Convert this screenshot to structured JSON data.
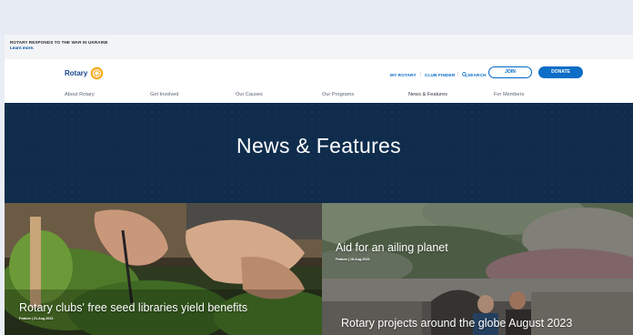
{
  "alert": {
    "headline": "ROTARY RESPONDS TO THE WAR IN UKRAINE",
    "link": "Learn more."
  },
  "header": {
    "logo_text": "Rotary",
    "utility_links": [
      "MY ROTARY",
      "CLUB FINDER",
      "SEARCH"
    ],
    "join_label": "JOIN",
    "donate_label": "DONATE"
  },
  "nav": {
    "items": [
      "About Rotary",
      "Get Involved",
      "Our Causes",
      "Our Programs",
      "News & Features",
      "For Members"
    ]
  },
  "hero": {
    "title": "News & Features"
  },
  "cards": [
    {
      "title": "Rotary clubs' free seed libraries yield benefits",
      "meta": "Feature | 21-Aug-2023"
    },
    {
      "title": "Aid for an ailing planet",
      "meta": "Feature | 18-Aug-2023"
    },
    {
      "title": "Rotary projects around the globe August 2023",
      "meta": ""
    }
  ],
  "colors": {
    "brand_blue": "#17458f",
    "link_blue": "#0067c8",
    "hero_navy": "#0f2c4c",
    "gold": "#f7a81b"
  },
  "icons": [
    "rotary-wheel-icon",
    "search-icon"
  ]
}
